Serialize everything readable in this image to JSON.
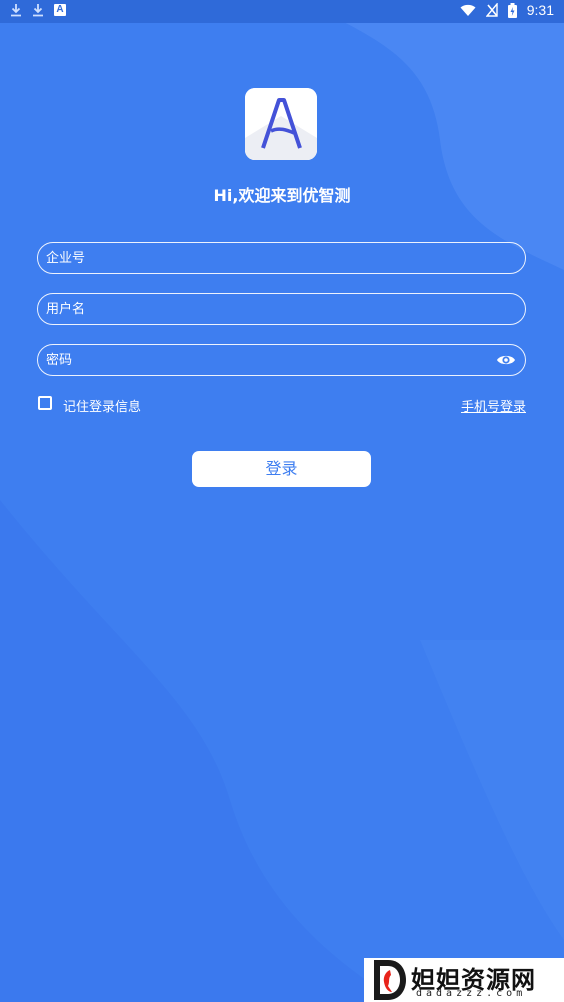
{
  "status_bar": {
    "time": "9:31",
    "icons": [
      "download-icon",
      "download-icon",
      "a-app-icon",
      "wifi-icon",
      "no-signal-icon",
      "battery-charging-icon"
    ]
  },
  "colors": {
    "background": "#3e7ef0",
    "background_light": "#4f8af3",
    "status_bar": "#2f6ad9",
    "button_text": "#3e7ef0",
    "logo_letter": "#4452d8"
  },
  "app": {
    "logo_letter": "A",
    "welcome": "Hi,欢迎来到优智测"
  },
  "form": {
    "company_placeholder": "企业号",
    "username_placeholder": "用户名",
    "password_placeholder": "密码",
    "remember_label": "记住登录信息",
    "phone_login_link": "手机号登录",
    "login_button": "登录"
  },
  "watermark": {
    "title": "妲妲资源网",
    "subtitle": "dadazzz.com"
  }
}
